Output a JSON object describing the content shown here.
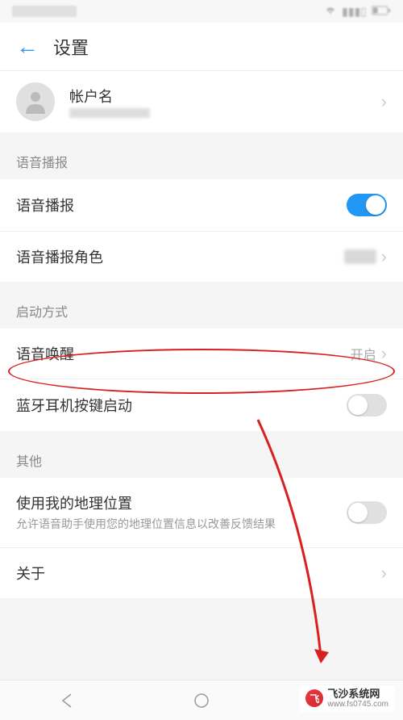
{
  "header": {
    "title": "设置"
  },
  "account": {
    "name": "帐户名"
  },
  "sections": {
    "voice_broadcast": {
      "header": "语音播报",
      "items": {
        "broadcast": {
          "label": "语音播报",
          "enabled": true
        },
        "role": {
          "label": "语音播报角色"
        }
      }
    },
    "launch_mode": {
      "header": "启动方式",
      "items": {
        "voice_wakeup": {
          "label": "语音唤醒",
          "value": "开启"
        },
        "bluetooth": {
          "label": "蓝牙耳机按键启动",
          "enabled": false
        }
      }
    },
    "other": {
      "header": "其他",
      "items": {
        "location": {
          "label": "使用我的地理位置",
          "sublabel": "允许语音助手使用您的地理位置信息以改善反馈结果",
          "enabled": false
        },
        "about": {
          "label": "关于"
        }
      }
    }
  },
  "watermark": {
    "name": "飞沙系统网",
    "url": "www.fs0745.com"
  },
  "colors": {
    "accent": "#2196f3",
    "annotation": "#d92020"
  }
}
